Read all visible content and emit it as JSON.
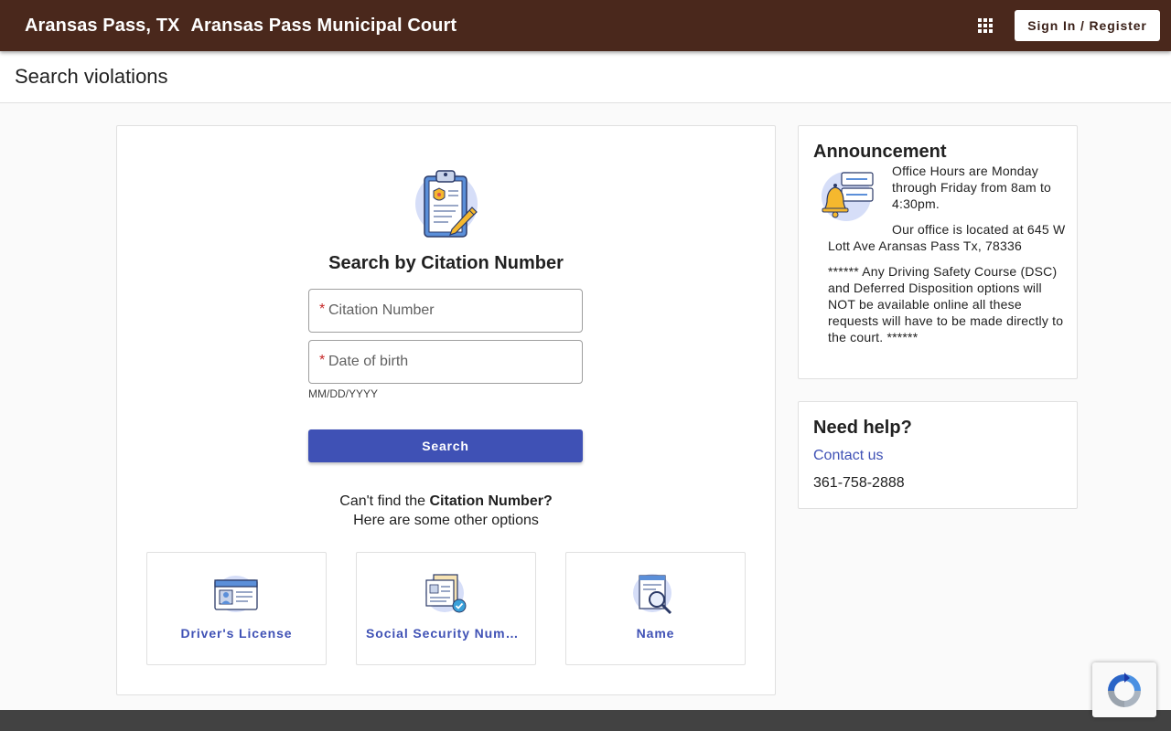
{
  "header": {
    "location": "Aransas Pass, TX",
    "court_name": "Aransas Pass Municipal Court",
    "apps_icon": "apps-grid-icon",
    "signin_label": "Sign In / Register",
    "background_color": "#4a281c"
  },
  "page": {
    "title": "Search violations"
  },
  "search": {
    "icon": "clipboard-badge-icon",
    "title": "Search by Citation Number",
    "required_marker": "*",
    "citation_placeholder": "Citation Number",
    "dob_placeholder": "Date of birth",
    "dob_hint": "MM/DD/YYYY",
    "button_label": "Search",
    "button_color": "#3f51b5",
    "cant_find_prefix": "Can't find the",
    "cant_find_bold": "Citation Number?",
    "other_options": "Here are some other options",
    "options": [
      {
        "label": "Driver's License",
        "icon": "id-card-icon"
      },
      {
        "label": "Social Security Number",
        "icon": "ssn-document-icon"
      },
      {
        "label": "Name",
        "icon": "magnifier-document-icon"
      }
    ]
  },
  "announcement": {
    "title": "Announcement",
    "icon": "bell-notification-icon",
    "paragraphs": [
      "Office Hours are Monday through Friday from 8am to 4:30pm.",
      "Our office is located at 645 W Lott Ave Aransas Pass Tx, 78336",
      "******  Any Driving Safety Course (DSC) and Deferred Disposition options will NOT be available online all these requests will have to be made directly to the court. ******"
    ]
  },
  "help": {
    "title": "Need help?",
    "contact_label": "Contact us",
    "phone": "361-758-2888"
  },
  "colors": {
    "accent": "#3f51b5",
    "footer": "#424242",
    "required": "#c62828"
  }
}
